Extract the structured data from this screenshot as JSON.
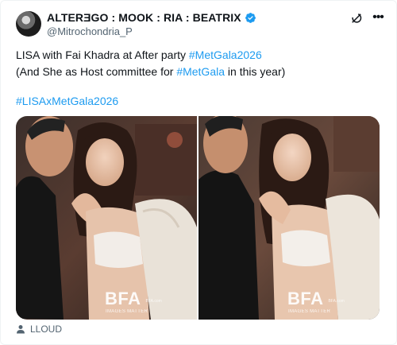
{
  "post": {
    "display_name": "ALTERƎGO : MOOK : RIA : BEATRIX",
    "handle": "@Mitrochondria_P",
    "verified": true,
    "text_line1_plain": "LISA with Fai Khadra at After party ",
    "text_line1_tag": "#MetGala2026",
    "text_line2_pre": "(And She as Host committee for ",
    "text_line2_tag": "#MetGala",
    "text_line2_post": " in this year)",
    "hashtag_line": "#LISAxMetGala2026"
  },
  "media": [
    {
      "watermark": "BFA",
      "watermark_sub": "IMAGES MATTER",
      "watermark_tag": "BFA.com"
    },
    {
      "watermark": "BFA",
      "watermark_sub": "IMAGES MATTER",
      "watermark_tag": "BFA.com"
    }
  ],
  "footer": {
    "label": "LLOUD",
    "icon": "person-icon"
  },
  "icons": [
    "verified-badge-icon",
    "grok-icon",
    "more-options-icon"
  ],
  "colors": {
    "link": "#1d9bf0",
    "text": "#0f1419",
    "muted": "#536471",
    "verified": "#1d9bf0"
  }
}
